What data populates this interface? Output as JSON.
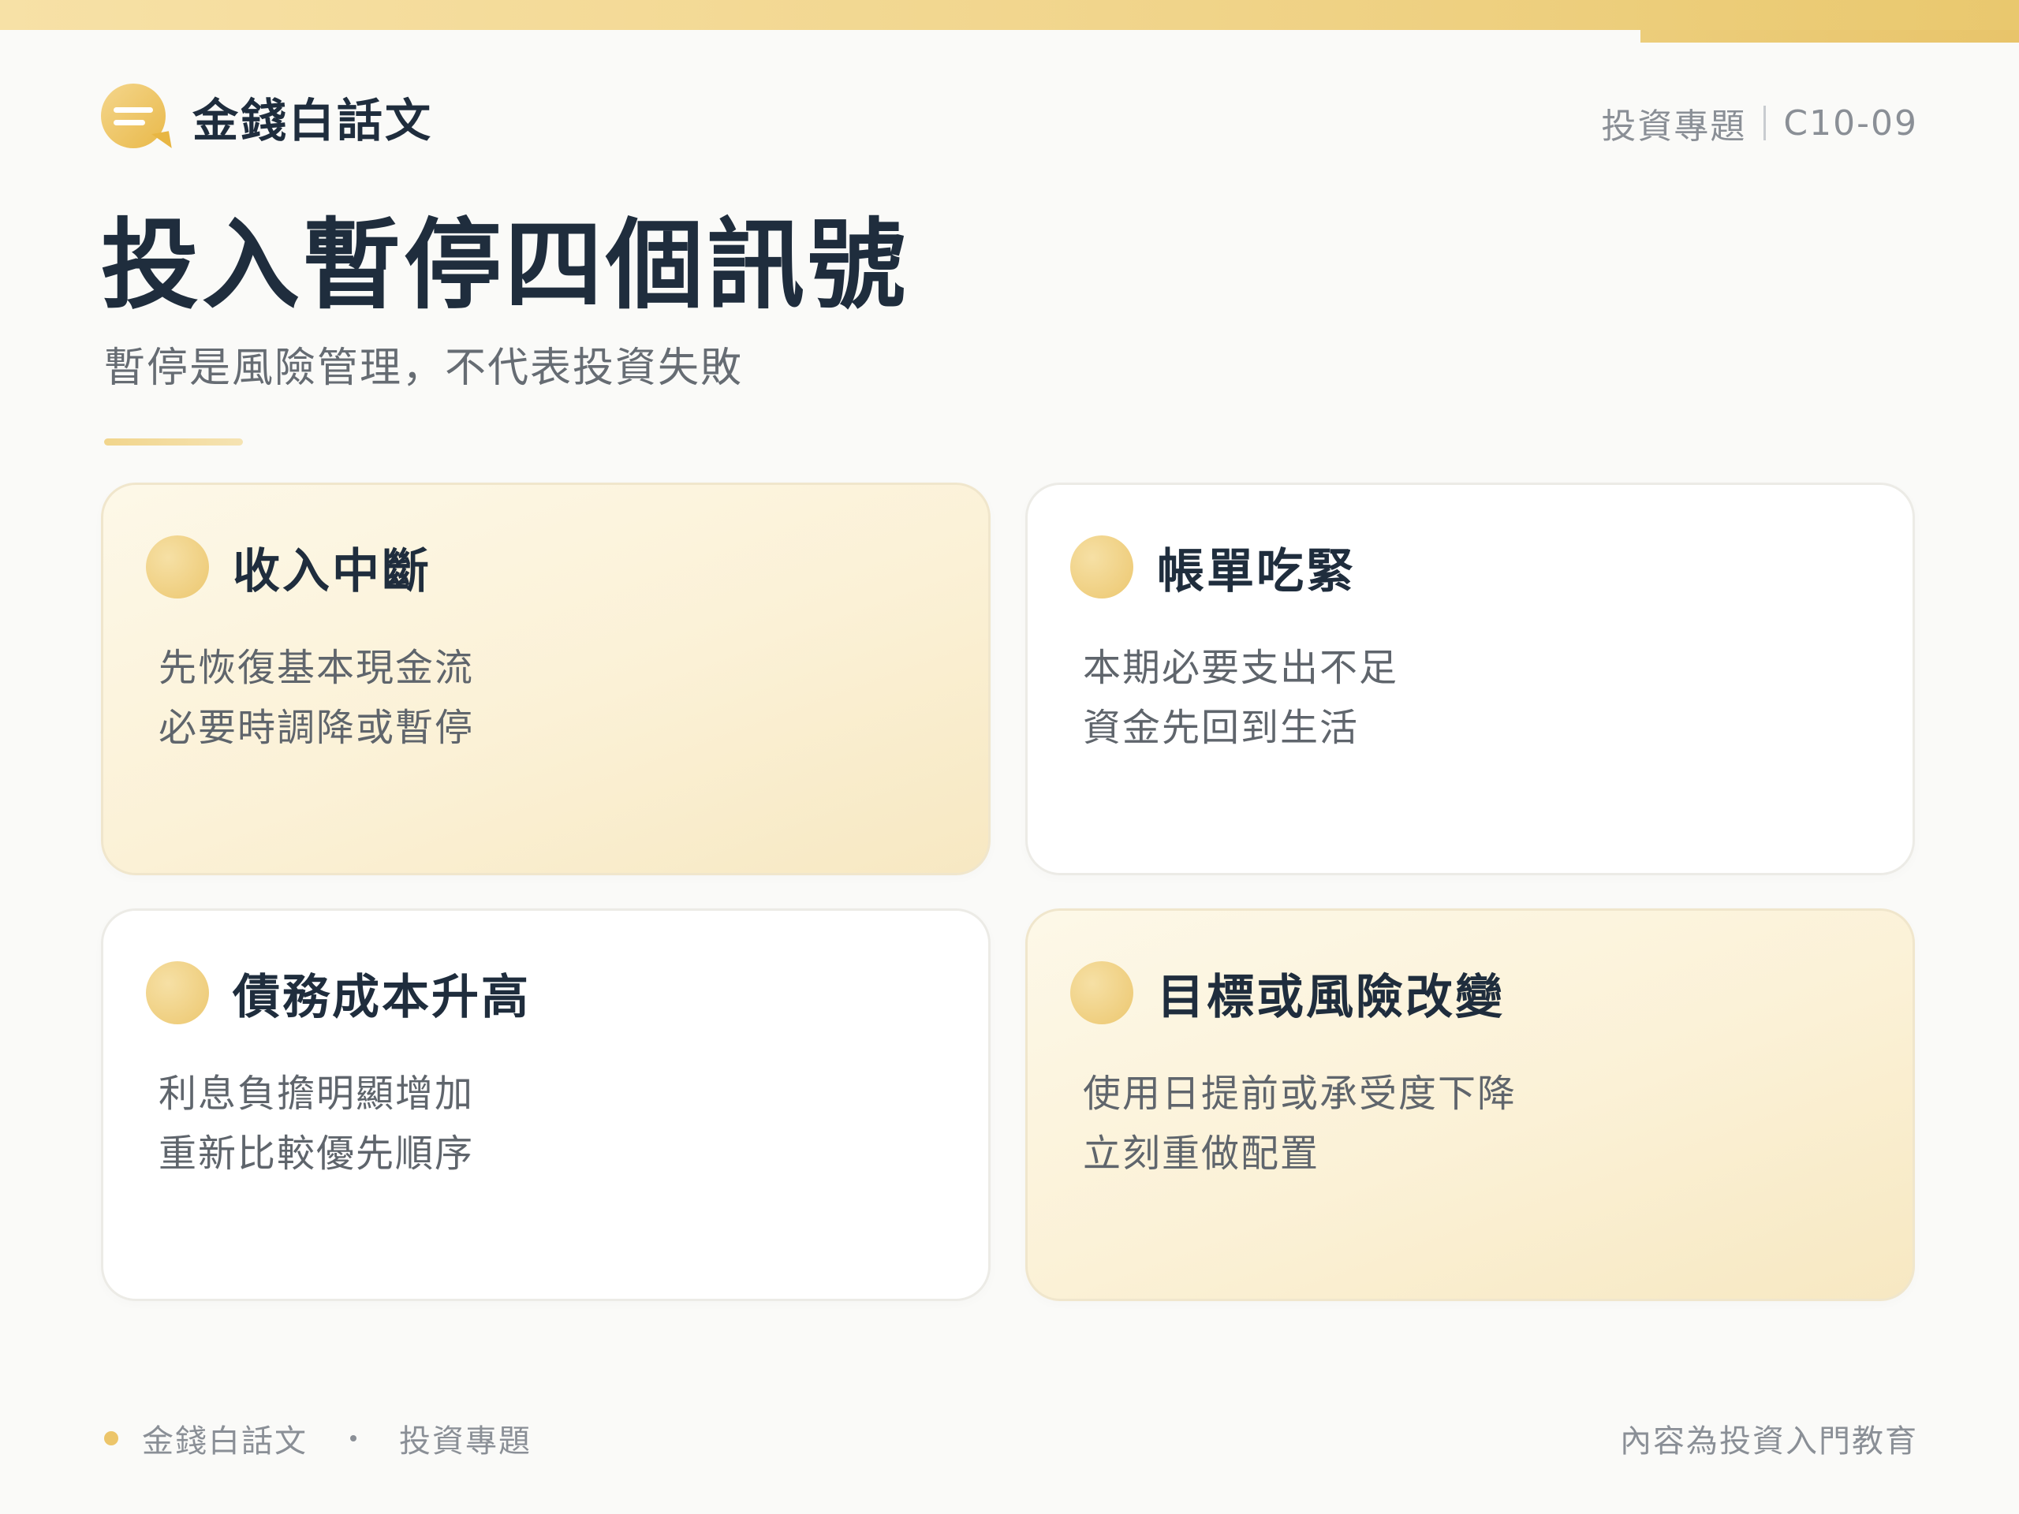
{
  "brand": {
    "name": "金錢白話文",
    "icon": "chat-bubble-icon"
  },
  "header": {
    "category": "投資專題",
    "code": "C10-09"
  },
  "title": "投入暫停四個訊號",
  "subtitle": "暫停是風險管理，不代表投資失敗",
  "colors": {
    "accent": "#ecc56a",
    "text_dark": "#1f2d3d",
    "text_muted": "#8a8f96",
    "card_accent_bg": "#fbf1d6"
  },
  "cards": [
    {
      "title": "收入中斷",
      "lines": [
        "先恢復基本現金流",
        "必要時調降或暫停"
      ]
    },
    {
      "title": "帳單吃緊",
      "lines": [
        "本期必要支出不足",
        "資金先回到生活"
      ]
    },
    {
      "title": "債務成本升高",
      "lines": [
        "利息負擔明顯增加",
        "重新比較優先順序"
      ]
    },
    {
      "title": "目標或風險改變",
      "lines": [
        "使用日提前或承受度下降",
        "立刻重做配置"
      ]
    }
  ],
  "footer": {
    "brand": "金錢白話文",
    "category": "投資專題",
    "note": "內容為投資入門教育"
  }
}
